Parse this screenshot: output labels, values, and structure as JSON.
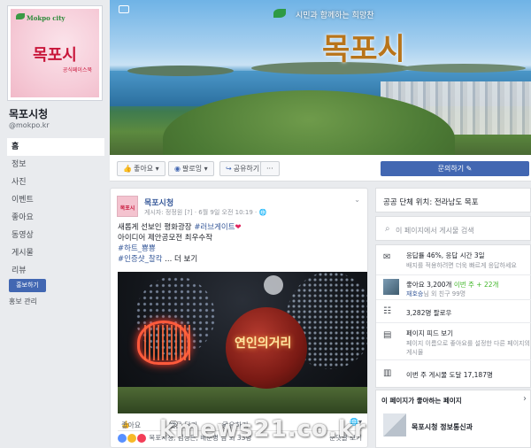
{
  "profile": {
    "logo_tag": "Mokpo city",
    "logo_name": "목포시",
    "logo_sub": "공식페이스북",
    "name": "목포시청",
    "handle": "@mokpo.kr"
  },
  "nav": {
    "items": [
      "홈",
      "정보",
      "사진",
      "이벤트",
      "좋아요",
      "동영상",
      "게시물",
      "리뷰"
    ],
    "active_index": 0,
    "promote_label": "홍보하기",
    "promo_manage_label": "홍보 관리"
  },
  "cover": {
    "slogan": "시민과 함께하는 희망찬",
    "title": "목포시"
  },
  "actionbar": {
    "like_label": "좋아요",
    "follow_label": "팔로잉",
    "share_label": "공유하기",
    "more_label": "···",
    "message_label": "문의하기 ✎"
  },
  "post": {
    "author": "목포시청",
    "meta": "게시자: 정정원 [?] · 6월 9일 오전 10:19 · 🌐",
    "avatar_text": "목포시",
    "line1_text": "새롭게 선보인 평화광장 ",
    "line1_tag": "#러브게이트",
    "line1_heart": "❤",
    "line2": "아이디어 제안공모전 최우수작",
    "line3_tag": "#하트_뿅뿅",
    "line4_tag": "#인증샷_찰칵",
    "line4_more": "... 더 보기",
    "photo_sign": "연인의거리",
    "actions": {
      "like": "좋아요",
      "comment": "댓글 달기",
      "share": "공유하기"
    },
    "reactions_names": "목포시청, 김성은, 배준병 님 외 33명",
    "reactions_right": "순댓글 보기"
  },
  "sidebar": {
    "location": "공공 단체 위치: 전라남도 목포",
    "search_placeholder": "이 페이지에서 게시물 검색",
    "response_title": "응답률 46%, 응답 시간 3일",
    "response_sub": "배지를 적용하려면 더욱 빠르게 응답하세요",
    "likes_line1_a": "좋아요 3,200개 ",
    "likes_line1_b": "이번 주 + 22개",
    "likes_line2_a": "재호승",
    "likes_line2_b": "님 외 친구 99명",
    "follows": "3,282명 팔로우",
    "feed_title": "페이지 피드 보기",
    "feed_sub1": "페이지 이름으로 좋아요를 설정한 다른 페이지의",
    "feed_sub2": "게시물",
    "reach": "이번 주 게시물 도달 17,187명",
    "liked_by_page_title": "이 페이지가 좋아하는 페이지",
    "liked_page_name": "목포시청 정보통신과"
  },
  "watermark": "kmews21.co.kr"
}
